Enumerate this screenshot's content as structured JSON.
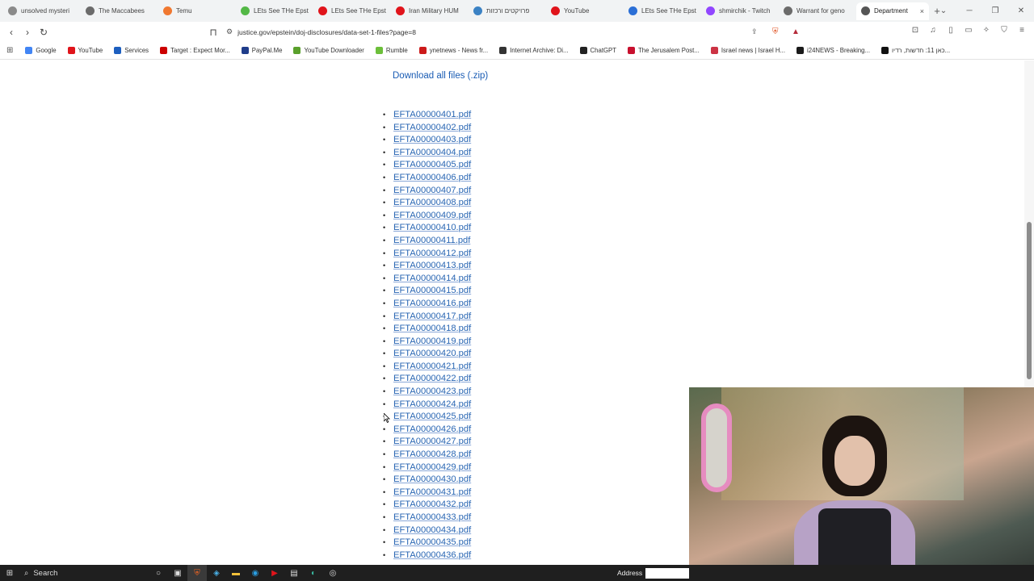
{
  "browser": {
    "tabs": [
      {
        "title": "unsolved mysteri",
        "color": "#8a8a8a"
      },
      {
        "title": "The Maccabees",
        "color": "#6b6b6b"
      },
      {
        "title": "Temu",
        "color": "#f07830"
      },
      {
        "title": "LEts See THe Epst",
        "color": "#53b846"
      },
      {
        "title": "LEts See THe Epst",
        "color": "#e0141b"
      },
      {
        "title": "Iran Military HUM",
        "color": "#e0141b"
      },
      {
        "title": "פרויקטים ורכזות",
        "color": "#3b82c4"
      },
      {
        "title": "YouTube",
        "color": "#e0141b"
      },
      {
        "title": "LEts See THe Epst",
        "color": "#2b6fd6"
      },
      {
        "title": "shmirchik - Twitch",
        "color": "#9146ff"
      },
      {
        "title": "Warrant for geno",
        "color": "#6b6b6b"
      },
      {
        "title": "Department",
        "color": "#555555",
        "active": true
      }
    ],
    "close_tab_glyph": "×",
    "new_tab_glyph": "+",
    "url": "justice.gov/epstein/doj-disclosures/data-set-1-files?page=8",
    "bookmarks": [
      {
        "label": "Google",
        "color": "#4285f4"
      },
      {
        "label": "YouTube",
        "color": "#e0141b"
      },
      {
        "label": "Services",
        "color": "#1d5fbf"
      },
      {
        "label": "Target : Expect Mor...",
        "color": "#cc0000"
      },
      {
        "label": "PayPal.Me",
        "color": "#1f3d8a"
      },
      {
        "label": "YouTube Downloader",
        "color": "#5aa02c"
      },
      {
        "label": "Rumble",
        "color": "#6cbf3a"
      },
      {
        "label": "ynetnews - News fr...",
        "color": "#cc1a1a"
      },
      {
        "label": "Internet Archive: Di...",
        "color": "#333333"
      },
      {
        "label": "ChatGPT",
        "color": "#222222"
      },
      {
        "label": "The Jerusalem Post...",
        "color": "#c8102e"
      },
      {
        "label": "Israel news | Israel H...",
        "color": "#cc3344"
      },
      {
        "label": "i24NEWS - Breaking...",
        "color": "#1a1a1a"
      },
      {
        "label": "כאן 11: חדשות, רדיו...",
        "color": "#111111"
      }
    ]
  },
  "page": {
    "download_all": "Download all files (.zip)",
    "bullet": "•",
    "files": [
      "EFTA00000401.pdf",
      "EFTA00000402.pdf",
      "EFTA00000403.pdf",
      "EFTA00000404.pdf",
      "EFTA00000405.pdf",
      "EFTA00000406.pdf",
      "EFTA00000407.pdf",
      "EFTA00000408.pdf",
      "EFTA00000409.pdf",
      "EFTA00000410.pdf",
      "EFTA00000411.pdf",
      "EFTA00000412.pdf",
      "EFTA00000413.pdf",
      "EFTA00000414.pdf",
      "EFTA00000415.pdf",
      "EFTA00000416.pdf",
      "EFTA00000417.pdf",
      "EFTA00000418.pdf",
      "EFTA00000419.pdf",
      "EFTA00000420.pdf",
      "EFTA00000421.pdf",
      "EFTA00000422.pdf",
      "EFTA00000423.pdf",
      "EFTA00000424.pdf",
      "EFTA00000425.pdf",
      "EFTA00000426.pdf",
      "EFTA00000427.pdf",
      "EFTA00000428.pdf",
      "EFTA00000429.pdf",
      "EFTA00000430.pdf",
      "EFTA00000431.pdf",
      "EFTA00000432.pdf",
      "EFTA00000433.pdf",
      "EFTA00000434.pdf",
      "EFTA00000435.pdf",
      "EFTA00000436.pdf"
    ]
  },
  "taskbar": {
    "search_label": "Search",
    "address_label": "Address"
  }
}
